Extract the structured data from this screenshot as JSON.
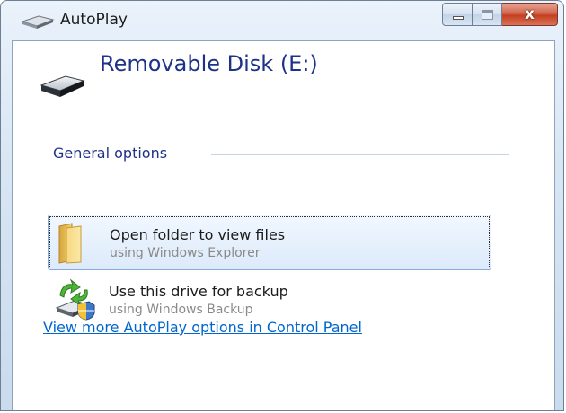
{
  "window": {
    "title": "AutoPlay",
    "controls": {
      "minimize": "minimize",
      "maximize": "maximize",
      "close": "x"
    }
  },
  "device": {
    "name": "Removable Disk (E:)",
    "icon": "removable-drive-icon"
  },
  "group": {
    "header": "General options"
  },
  "options": [
    {
      "title": "Open folder to view files",
      "subtitle": "using Windows Explorer",
      "icon": "folder-icon",
      "selected": true
    },
    {
      "title": "Use this drive for backup",
      "subtitle": "using Windows Backup",
      "icon": "backup-icon",
      "selected": false
    }
  ],
  "footer": {
    "link": "View more AutoPlay options in Control Panel"
  },
  "colors": {
    "heading_blue": "#1e3287",
    "link_blue": "#0066cc",
    "close_red": "#c3401f",
    "selection_border": "#84acdd"
  }
}
